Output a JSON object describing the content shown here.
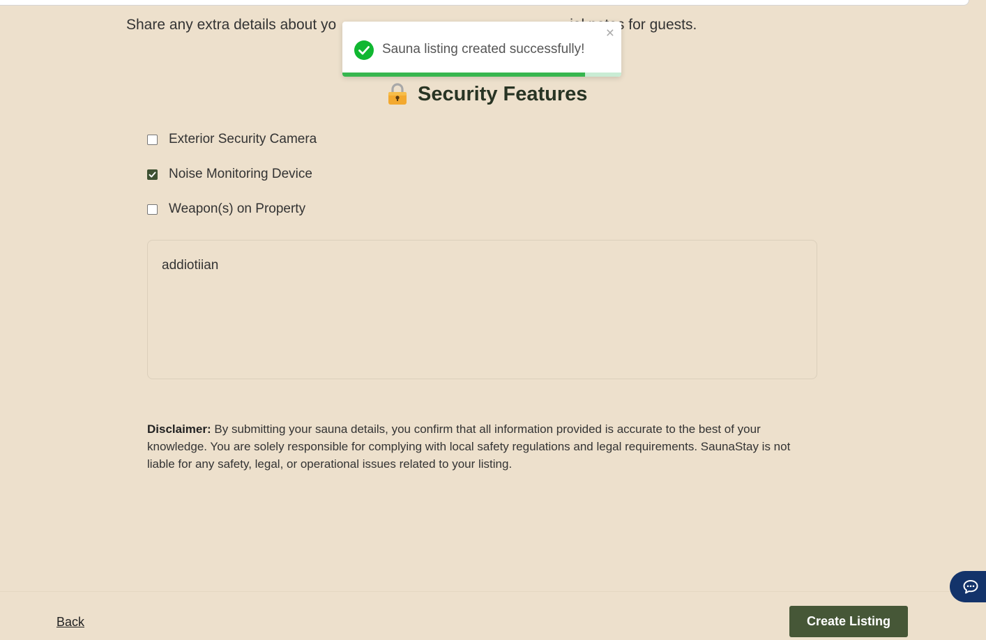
{
  "intro": {
    "visible_text_left": "Share any extra details about yo",
    "visible_text_right": "ial notes for guests."
  },
  "toast": {
    "message": "Sauna listing created successfully!",
    "close_symbol": "×",
    "icon": "check-circle-icon",
    "progress_remaining": 0.87,
    "colors": {
      "success": "#10b731",
      "progress": "#37b64f"
    }
  },
  "section": {
    "icon": "lock-emoji",
    "title": "Security Features"
  },
  "security_options": [
    {
      "label": "Exterior Security Camera",
      "checked": false
    },
    {
      "label": "Noise Monitoring Device",
      "checked": true
    },
    {
      "label": "Weapon(s) on Property",
      "checked": false
    }
  ],
  "notes": {
    "value": "addiotiian"
  },
  "disclaimer": {
    "label": "Disclaimer:",
    "text": " By submitting your sauna details, you confirm that all information provided is accurate to the best of your knowledge. You are solely responsible for complying with local safety regulations and legal requirements. SaunaStay is not liable for any safety, legal, or operational issues related to your listing."
  },
  "footer": {
    "back_label": "Back",
    "create_label": "Create Listing"
  },
  "chat": {
    "icon": "chat-bubble-icon"
  },
  "colors": {
    "background": "#ede0cc",
    "primary_button": "#465737",
    "heading": "#283424",
    "chat_button": "#13336a"
  }
}
